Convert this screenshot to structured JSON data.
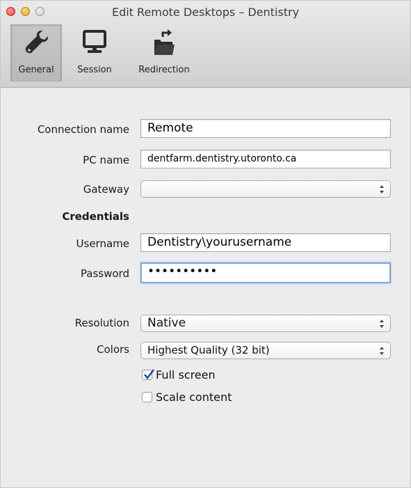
{
  "window": {
    "title": "Edit Remote Desktops – Dentistry"
  },
  "toolbar": {
    "items": [
      {
        "label": "General",
        "icon": "wrench-icon",
        "selected": true
      },
      {
        "label": "Session",
        "icon": "monitor-icon",
        "selected": false
      },
      {
        "label": "Redirection",
        "icon": "folder-redirect-icon",
        "selected": false
      }
    ]
  },
  "form": {
    "connection_name": {
      "label": "Connection name",
      "value": "Remote"
    },
    "pc_name": {
      "label": "PC name",
      "value": "dentfarm.dentistry.utoronto.ca"
    },
    "gateway": {
      "label": "Gateway",
      "value": ""
    },
    "credentials_heading": "Credentials",
    "username": {
      "label": "Username",
      "value": "Dentistry\\yourusername"
    },
    "password": {
      "label": "Password",
      "value": "••••••••••"
    },
    "resolution": {
      "label": "Resolution",
      "value": "Native"
    },
    "colors": {
      "label": "Colors",
      "value": "Highest Quality (32 bit)"
    },
    "full_screen": {
      "label": "Full screen",
      "checked": true
    },
    "scale_content": {
      "label": "Scale content",
      "checked": false
    }
  },
  "colors": {
    "focus_ring": "#7aa7df",
    "checkmark": "#1f4f9a"
  }
}
